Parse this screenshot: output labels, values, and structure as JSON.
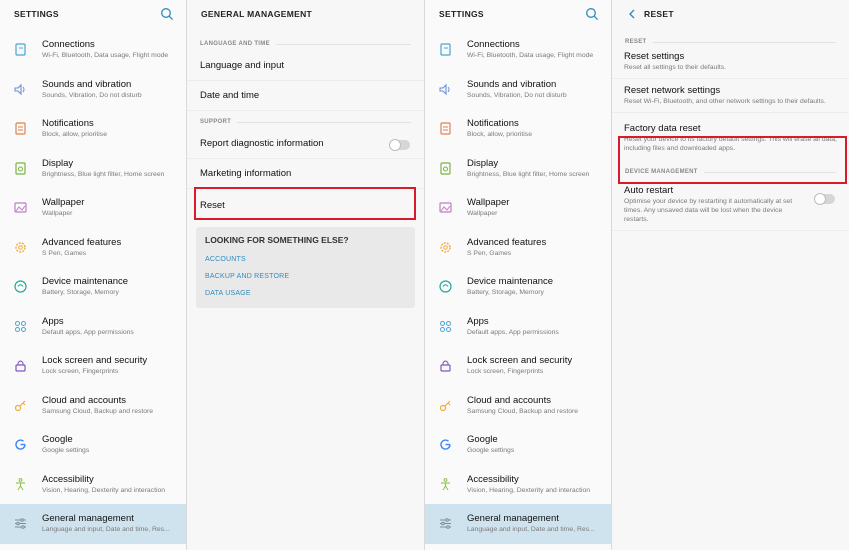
{
  "left_settings": {
    "title": "SETTINGS",
    "items": [
      {
        "title": "Connections",
        "sub": "Wi-Fi, Bluetooth, Data usage, Flight mode",
        "icon": "connections-icon"
      },
      {
        "title": "Sounds and vibration",
        "sub": "Sounds, Vibration, Do not disturb",
        "icon": "speaker-icon"
      },
      {
        "title": "Notifications",
        "sub": "Block, allow, prioritise",
        "icon": "notifications-icon"
      },
      {
        "title": "Display",
        "sub": "Brightness, Blue light filter, Home screen",
        "icon": "display-icon"
      },
      {
        "title": "Wallpaper",
        "sub": "Wallpaper",
        "icon": "wallpaper-icon"
      },
      {
        "title": "Advanced features",
        "sub": "S Pen, Games",
        "icon": "gear-icon"
      },
      {
        "title": "Device maintenance",
        "sub": "Battery, Storage, Memory",
        "icon": "maintenance-icon"
      },
      {
        "title": "Apps",
        "sub": "Default apps, App permissions",
        "icon": "apps-icon"
      },
      {
        "title": "Lock screen and security",
        "sub": "Lock screen, Fingerprints",
        "icon": "lock-icon"
      },
      {
        "title": "Cloud and accounts",
        "sub": "Samsung Cloud, Backup and restore",
        "icon": "key-icon"
      },
      {
        "title": "Google",
        "sub": "Google settings",
        "icon": "google-icon"
      },
      {
        "title": "Accessibility",
        "sub": "Vision, Hearing, Dexterity and interaction",
        "icon": "accessibility-icon"
      },
      {
        "title": "General management",
        "sub": "Language and input, Date and time, Res...",
        "icon": "sliders-icon"
      }
    ]
  },
  "general_management": {
    "title": "GENERAL MANAGEMENT",
    "section_language": "LANGUAGE AND TIME",
    "language_input": "Language and input",
    "date_time": "Date and time",
    "section_support": "SUPPORT",
    "report_diag": "Report diagnostic information",
    "marketing": "Marketing information",
    "reset": "Reset",
    "looking_title": "LOOKING FOR SOMETHING ELSE?",
    "links": [
      "ACCOUNTS",
      "BACKUP AND RESTORE",
      "DATA USAGE"
    ]
  },
  "reset_page": {
    "title": "RESET",
    "section_reset": "RESET",
    "items": [
      {
        "title": "Reset settings",
        "sub": "Reset all settings to their defaults."
      },
      {
        "title": "Reset network settings",
        "sub": "Reset Wi-Fi, Bluetooth, and other network settings to their defaults."
      },
      {
        "title": "Factory data reset",
        "sub": "Reset your device to its factory default settings. This will erase all data, including files and downloaded apps."
      }
    ],
    "section_device": "DEVICE MANAGEMENT",
    "auto_restart": {
      "title": "Auto restart",
      "sub": "Optimise your device by restarting it automatically at set times. Any unsaved data will be lost when the device restarts."
    }
  },
  "colors": {
    "accent": "#2f8cbf",
    "highlight": "#d81b2b",
    "selected": "#cfe3ee"
  }
}
